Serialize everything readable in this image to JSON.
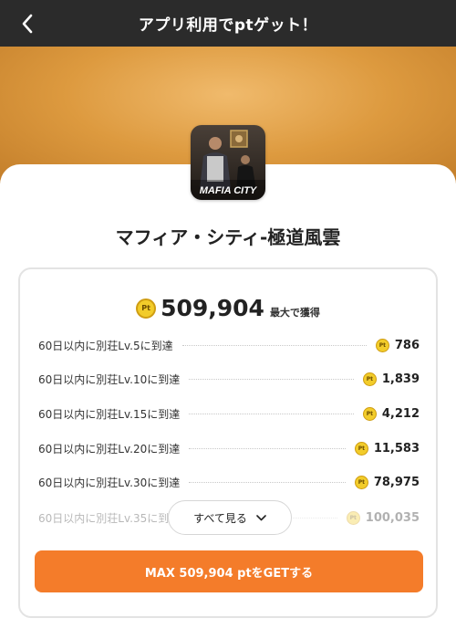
{
  "header": {
    "title": "アプリ利用でptゲット！",
    "back_icon": "chevron-left-icon"
  },
  "colors": {
    "header_bg": "#2b2b2b",
    "hero_gradient": [
      "#f0ba6c",
      "#c37e2a"
    ],
    "cta_bg": "#f47c2a",
    "coin": "#f2cc2a"
  },
  "app": {
    "name": "マフィア・シティ-極道風雲",
    "icon_text": "MAFIA CITY"
  },
  "points": {
    "coin_text": "Pt",
    "total": "509,904",
    "total_suffix": "最大で獲得"
  },
  "tasks": [
    {
      "label": "60日以内に別荘Lv.5に到達",
      "points": "786"
    },
    {
      "label": "60日以内に別荘Lv.10に到達",
      "points": "1,839"
    },
    {
      "label": "60日以内に別荘Lv.15に到達",
      "points": "4,212"
    },
    {
      "label": "60日以内に別荘Lv.20に到達",
      "points": "11,583"
    },
    {
      "label": "60日以内に別荘Lv.30に到達",
      "points": "78,975"
    },
    {
      "label": "60日以内に別荘Lv.35に到達",
      "points": "100,035"
    }
  ],
  "see_all": {
    "label": "すべて見る",
    "icon": "chevron-down-icon"
  },
  "cta": {
    "label": "MAX 509,904 ptをGETする"
  }
}
